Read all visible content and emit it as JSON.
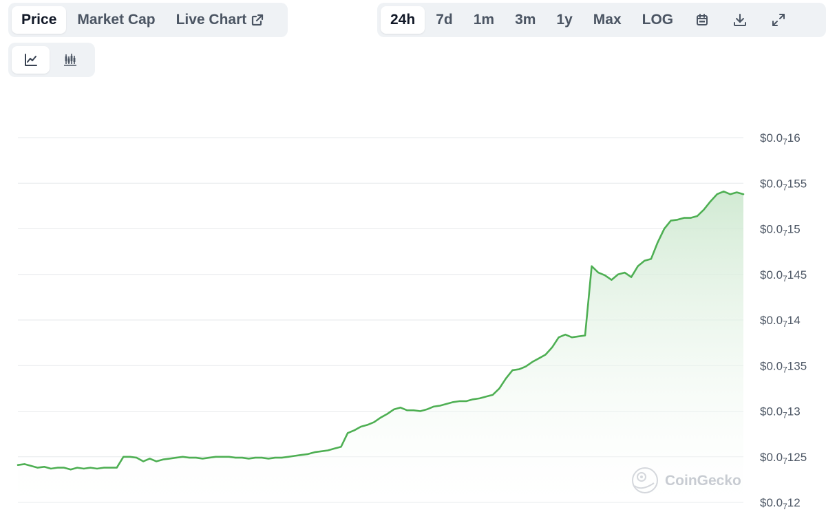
{
  "tabs": {
    "views": [
      {
        "label": "Price",
        "active": true
      },
      {
        "label": "Market Cap",
        "active": false
      },
      {
        "label": "Live Chart",
        "active": false,
        "icon": "external-link-icon"
      }
    ],
    "ranges": [
      {
        "label": "24h",
        "active": true
      },
      {
        "label": "7d",
        "active": false
      },
      {
        "label": "1m",
        "active": false
      },
      {
        "label": "3m",
        "active": false
      },
      {
        "label": "1y",
        "active": false
      },
      {
        "label": "Max",
        "active": false
      },
      {
        "label": "LOG",
        "active": false
      }
    ],
    "range_icons": [
      "calendar-icon",
      "download-icon",
      "fullscreen-icon"
    ],
    "chart_types": [
      {
        "icon": "line-chart-icon",
        "active": true
      },
      {
        "icon": "candlestick-icon",
        "active": false
      }
    ]
  },
  "watermark": {
    "label": "CoinGecko",
    "icon": "coingecko-logo-icon"
  },
  "colors": {
    "line": "#4eaf53",
    "fill_top": "#cfe9d1",
    "grid": "#e6e8eb",
    "tab_bg": "#eff2f5"
  },
  "chart_data": {
    "type": "area",
    "title": "",
    "xlabel": "",
    "ylabel": "",
    "x_unit": "24h",
    "grid": true,
    "ylim": [
      1.2e-08,
      1.6e-08
    ],
    "y_ticks": [
      {
        "value": 1.6e-08,
        "prefix": "$0.0",
        "sub": "7",
        "digits": "16"
      },
      {
        "value": 1.55e-08,
        "prefix": "$0.0",
        "sub": "7",
        "digits": "155"
      },
      {
        "value": 1.5e-08,
        "prefix": "$0.0",
        "sub": "7",
        "digits": "15"
      },
      {
        "value": 1.45e-08,
        "prefix": "$0.0",
        "sub": "7",
        "digits": "145"
      },
      {
        "value": 1.4e-08,
        "prefix": "$0.0",
        "sub": "7",
        "digits": "14"
      },
      {
        "value": 1.35e-08,
        "prefix": "$0.0",
        "sub": "7",
        "digits": "135"
      },
      {
        "value": 1.3e-08,
        "prefix": "$0.0",
        "sub": "7",
        "digits": "13"
      },
      {
        "value": 1.25e-08,
        "prefix": "$0.0",
        "sub": "7",
        "digits": "125"
      },
      {
        "value": 1.2e-08,
        "prefix": "$0.0",
        "sub": "7",
        "digits": "12"
      }
    ],
    "series": [
      {
        "values": [
          1.241e-08,
          1.242e-08,
          1.24e-08,
          1.238e-08,
          1.239e-08,
          1.237e-08,
          1.238e-08,
          1.238e-08,
          1.236e-08,
          1.238e-08,
          1.237e-08,
          1.238e-08,
          1.237e-08,
          1.238e-08,
          1.238e-08,
          1.238e-08,
          1.25e-08,
          1.25e-08,
          1.249e-08,
          1.245e-08,
          1.248e-08,
          1.245e-08,
          1.247e-08,
          1.248e-08,
          1.249e-08,
          1.25e-08,
          1.249e-08,
          1.249e-08,
          1.248e-08,
          1.249e-08,
          1.25e-08,
          1.25e-08,
          1.25e-08,
          1.249e-08,
          1.249e-08,
          1.248e-08,
          1.249e-08,
          1.249e-08,
          1.248e-08,
          1.249e-08,
          1.249e-08,
          1.25e-08,
          1.251e-08,
          1.252e-08,
          1.253e-08,
          1.255e-08,
          1.256e-08,
          1.257e-08,
          1.259e-08,
          1.261e-08,
          1.276e-08,
          1.279e-08,
          1.283e-08,
          1.285e-08,
          1.288e-08,
          1.293e-08,
          1.297e-08,
          1.302e-08,
          1.304e-08,
          1.301e-08,
          1.301e-08,
          1.3e-08,
          1.302e-08,
          1.305e-08,
          1.306e-08,
          1.308e-08,
          1.31e-08,
          1.311e-08,
          1.311e-08,
          1.313e-08,
          1.314e-08,
          1.316e-08,
          1.318e-08,
          1.325e-08,
          1.336e-08,
          1.345e-08,
          1.346e-08,
          1.349e-08,
          1.354e-08,
          1.358e-08,
          1.362e-08,
          1.37e-08,
          1.381e-08,
          1.384e-08,
          1.381e-08,
          1.382e-08,
          1.383e-08,
          1.459e-08,
          1.452e-08,
          1.449e-08,
          1.444e-08,
          1.45e-08,
          1.452e-08,
          1.447e-08,
          1.459e-08,
          1.465e-08,
          1.467e-08,
          1.485e-08,
          1.5e-08,
          1.509e-08,
          1.51e-08,
          1.512e-08,
          1.512e-08,
          1.514e-08,
          1.521e-08,
          1.53e-08,
          1.538e-08,
          1.541e-08,
          1.538e-08,
          1.54e-08,
          1.538e-08
        ]
      }
    ]
  }
}
